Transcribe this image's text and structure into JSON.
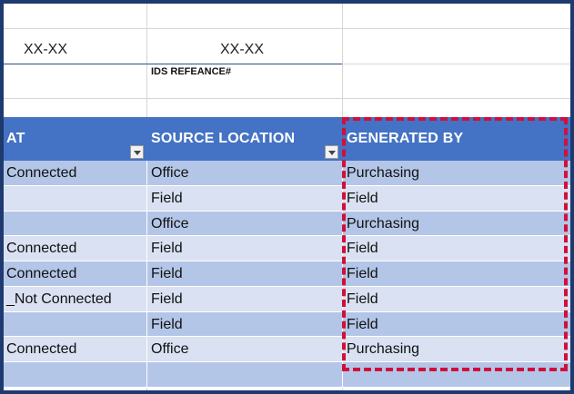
{
  "top_area": {
    "code_left": "XX-XX",
    "code_middle": "XX-XX",
    "ids_label": "IDS REFEANCE#"
  },
  "table": {
    "headers": [
      "AT",
      "SOURCE LOCATION",
      "GENERATED BY"
    ],
    "rows": [
      [
        "Connected",
        "Office",
        "Purchasing"
      ],
      [
        "",
        "Field",
        "Field"
      ],
      [
        "",
        "Office",
        "Purchasing"
      ],
      [
        "Connected",
        "Field",
        "Field"
      ],
      [
        "Connected",
        "Field",
        "Field"
      ],
      [
        "_Not Connected",
        "Field",
        "Field"
      ],
      [
        "",
        "Field",
        "Field"
      ],
      [
        "Connected",
        "Office",
        "Purchasing"
      ],
      [
        "",
        "",
        ""
      ]
    ]
  },
  "colors": {
    "header_bg": "#4472c4",
    "band_odd": "#b4c6e7",
    "band_even": "#d9e1f2",
    "highlight_dash": "#d0103a",
    "frame": "#1f3a6e"
  }
}
